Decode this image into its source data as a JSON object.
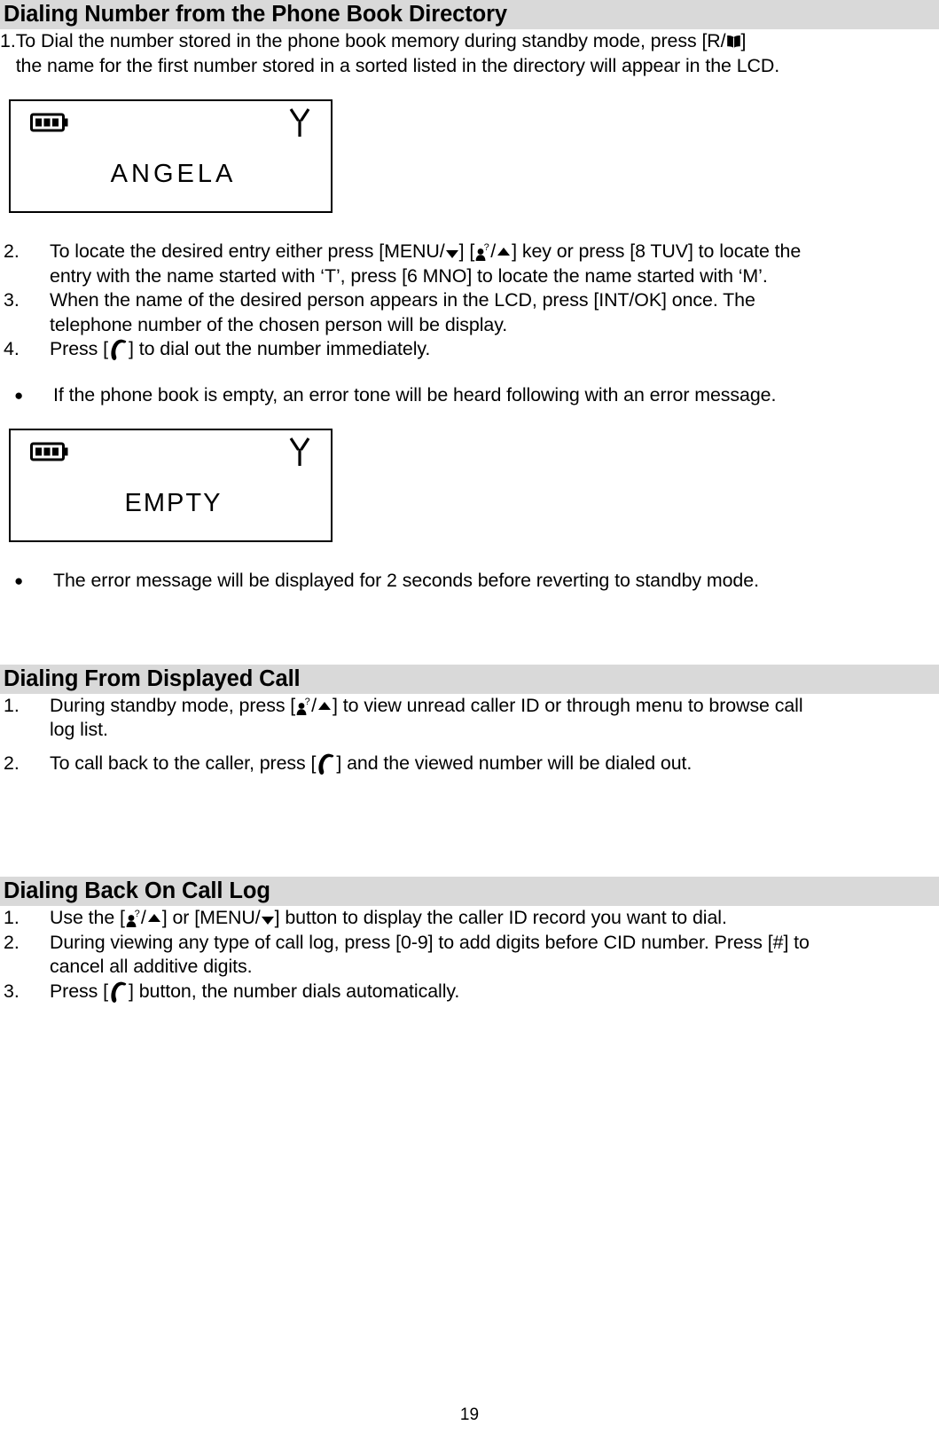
{
  "page": {
    "number": "19"
  },
  "sections": [
    {
      "heading": "Dialing Number from the Phone Book Directory",
      "items": [
        {
          "marker": "1.",
          "text_before": "To Dial the number stored in the phone book memory during standby mode, press [R/",
          "text_after": "]",
          "line2": "the name for the first number stored in a sorted listed in the directory will appear in the LCD."
        }
      ]
    }
  ],
  "lcd1": {
    "battery_icon": "battery-full-icon",
    "antenna_icon": "antenna-icon",
    "text": "ANGELA"
  },
  "lcd2": {
    "battery_icon": "battery-full-icon",
    "antenna_icon": "antenna-icon",
    "text": "EMPTY"
  },
  "step2": {
    "marker": "2.",
    "t1": "To locate the desired entry either press [MENU/",
    "t2": "] [",
    "t3": "/",
    "t4": "] key or press [8 TUV] to locate the",
    "line2": "entry with the name started with ‘T’, press [6 MNO] to locate the name started with ‘M’."
  },
  "step3": {
    "marker": "3.",
    "line1": "When the name of the desired person appears in the LCD, press [INT/OK] once. The",
    "line2": "telephone number of the chosen person will be display."
  },
  "step4": {
    "marker": "4.",
    "t1": "Press [",
    "t2": "] to dial out the number immediately."
  },
  "bullet1": {
    "marker": "●",
    "text": "If the phone book is empty, an error tone will be heard following with an error message."
  },
  "bullet2": {
    "marker": "●",
    "text": "The error message will be displayed for 2 seconds before reverting to standby mode."
  },
  "section2": {
    "heading": "Dialing From Displayed Call",
    "item1": {
      "marker": "1.",
      "t1": "During standby mode, press [",
      "t2": "/",
      "t3": "] to view unread caller ID or through menu to browse call",
      "line2": "log list."
    },
    "item2": {
      "marker": "2.",
      "t1": "To call back to the caller, press [",
      "t2": "] and the viewed number will be dialed out."
    }
  },
  "section3": {
    "heading": "Dialing Back On Call Log",
    "item1": {
      "marker": "1.",
      "t1": "Use the [",
      "t2": "/",
      "t3": "] or [MENU/",
      "t4": "] button to display the caller ID record you want to dial."
    },
    "item2": {
      "marker": "2.",
      "line1": "During viewing any type of call log, press [0-9] to add digits before CID number. Press [#] to",
      "line2": "cancel all additive digits."
    },
    "item3": {
      "marker": "3.",
      "t1": "Press [",
      "t2": "] button, the number dials automatically."
    }
  }
}
